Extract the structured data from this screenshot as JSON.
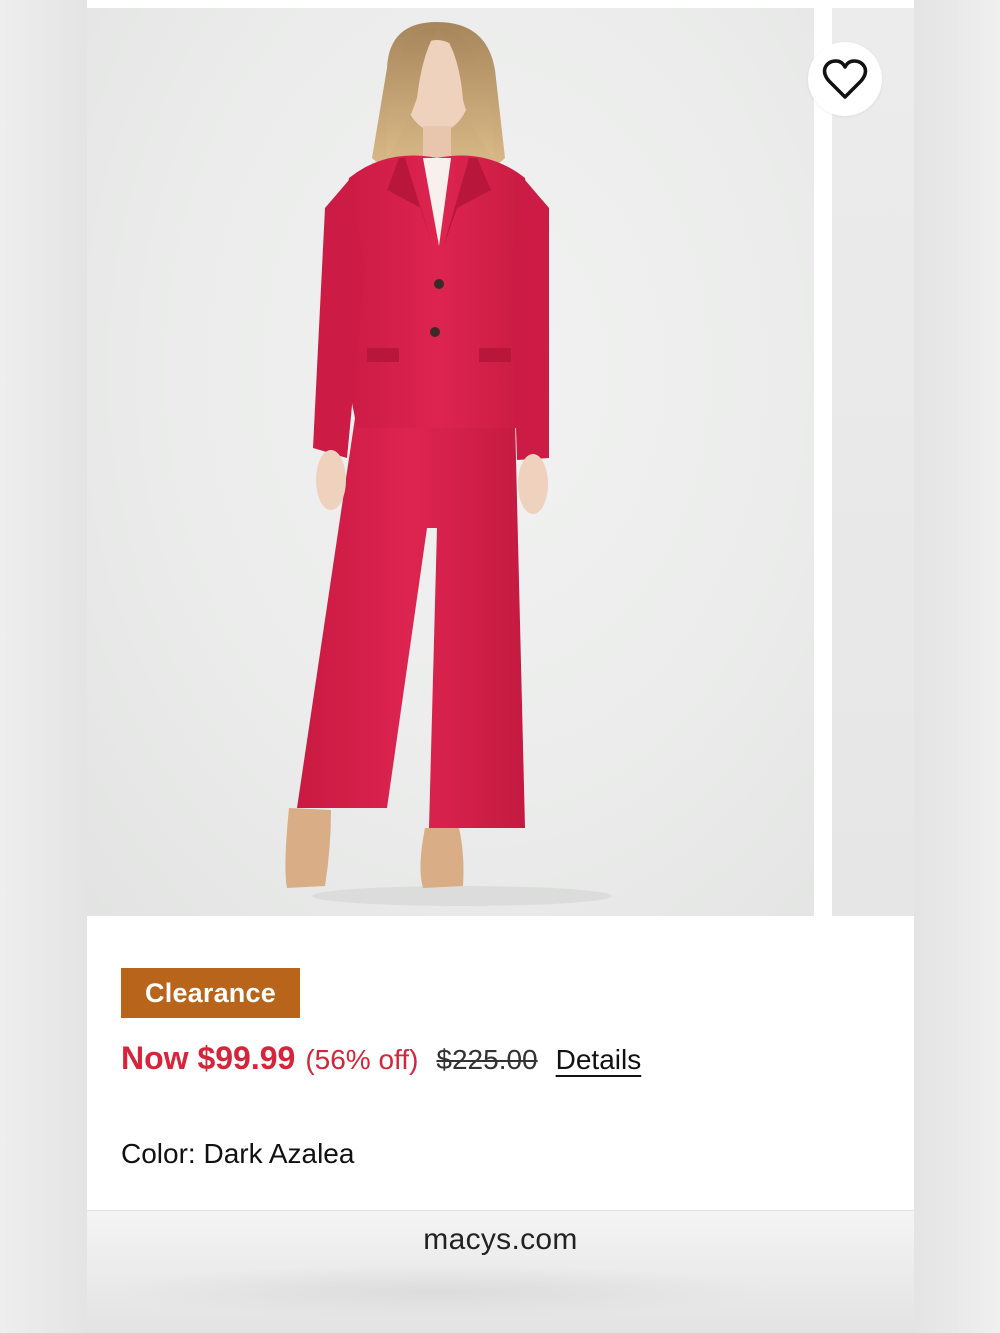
{
  "product": {
    "image_alt": "Woman wearing a dark azalea pink two-button blazer and wide-leg pants suit with nude heels",
    "color_hex": "#d8204a"
  },
  "wishlist": {
    "icon": "heart-outline-icon"
  },
  "badge": {
    "label": "Clearance",
    "color": "#b8651b"
  },
  "pricing": {
    "now": "Now $99.99",
    "discount": "(56% off)",
    "was": "$225.00",
    "details_label": "Details",
    "sale_color": "#d6253a"
  },
  "color": {
    "label": "Color: Dark Azalea"
  },
  "browser": {
    "domain": "macys.com"
  }
}
